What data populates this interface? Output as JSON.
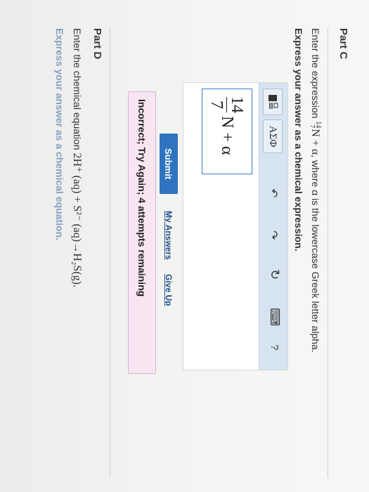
{
  "part_c": {
    "title": "Part C",
    "prompt_prefix": "Enter the expression",
    "prompt_nuclide_mass": "14",
    "prompt_nuclide_atomic": "7",
    "prompt_nuclide_symbol": "N + α",
    "prompt_suffix": ", where α is the lowercase Greek letter alpha.",
    "instruction": "Express your answer as a chemical expression."
  },
  "toolbar": {
    "template_icon": "template-fraction-icon",
    "greek_label": "ΑΣΦ",
    "undo_icon": "↶",
    "redo_icon": "↷",
    "reset_icon": "↻",
    "keyboard_icon": "⌨",
    "help_label": "?"
  },
  "answer": {
    "numerator": "14",
    "denominator": "7",
    "rest": "N + α"
  },
  "actions": {
    "submit_label": "Submit",
    "my_answers_label": "My Answers",
    "give_up_label": "Give Up"
  },
  "feedback": {
    "text": "Incorrect; Try Again; 4 attempts remaining"
  },
  "part_d": {
    "title": "Part D",
    "prompt_prefix": "Enter the chemical equation",
    "equation": "2H⁺ (aq) + S²⁻ (aq)→H₂S(g).",
    "cut_line": "Express your answer as a chemical equation."
  },
  "colors": {
    "accent": "#2f74bf",
    "feedback_bg": "#f7e5f2",
    "toolbar_bg": "#d6e3f0"
  }
}
